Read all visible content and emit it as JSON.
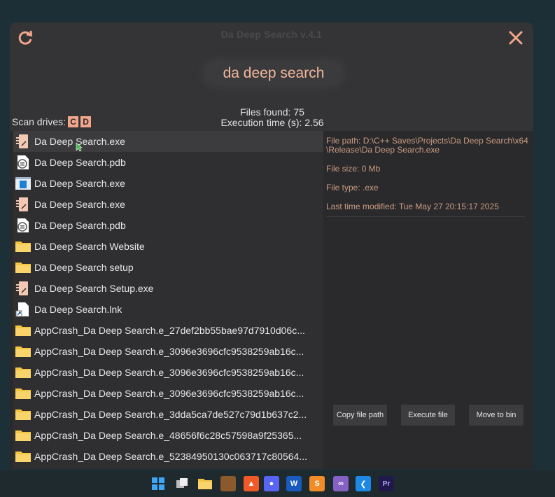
{
  "window": {
    "title": "Da Deep Search v.4.1"
  },
  "search": {
    "value": "da deep search"
  },
  "stats": {
    "files_found": "Files found: 75",
    "execution_time": "Execution time (s): 2.56"
  },
  "scan": {
    "label": "Scan drives:",
    "drives": [
      "C",
      "D"
    ]
  },
  "files": [
    {
      "name": "Da Deep Search.exe",
      "icon": "exe-icon",
      "selected": true
    },
    {
      "name": "Da Deep Search.pdb",
      "icon": "pdb-icon"
    },
    {
      "name": "Da Deep Search.exe",
      "icon": "window-app-icon"
    },
    {
      "name": "Da Deep Search.exe",
      "icon": "exe-icon"
    },
    {
      "name": "Da Deep Search.pdb",
      "icon": "pdb-icon"
    },
    {
      "name": "Da Deep Search Website",
      "icon": "folder-icon"
    },
    {
      "name": "Da Deep Search setup",
      "icon": "folder-icon"
    },
    {
      "name": "Da Deep Search Setup.exe",
      "icon": "exe-icon"
    },
    {
      "name": "Da Deep Search.lnk",
      "icon": "shortcut-icon"
    },
    {
      "name": "AppCrash_Da Deep Search.e_27def2bb55bae97d7910d06c...",
      "icon": "folder-icon"
    },
    {
      "name": "AppCrash_Da Deep Search.e_3096e3696cfc9538259ab16c...",
      "icon": "folder-icon"
    },
    {
      "name": "AppCrash_Da Deep Search.e_3096e3696cfc9538259ab16c...",
      "icon": "folder-icon"
    },
    {
      "name": "AppCrash_Da Deep Search.e_3096e3696cfc9538259ab16c...",
      "icon": "folder-icon"
    },
    {
      "name": "AppCrash_Da Deep Search.e_3dda5ca7de527c79d1b637c2...",
      "icon": "folder-icon"
    },
    {
      "name": "AppCrash_Da Deep Search.e_48656f6c28c57598a9f25365...",
      "icon": "folder-icon"
    },
    {
      "name": "AppCrash_Da Deep Search.e_52384950130c063717c80564...",
      "icon": "folder-icon"
    }
  ],
  "details": {
    "path": "File path: D:\\C++ Saves\\Projects\\Da Deep Search\\x64\\Release\\Da Deep Search.exe",
    "size": "File size: 0 Mb",
    "type": "File type: .exe",
    "modified": "Last time modified: Tue May 27 20:15:17 2025"
  },
  "actions": {
    "copy": "Copy file path",
    "execute": "Execute file",
    "bin": "Move to bin"
  },
  "taskbar": [
    "windows-start-icon",
    "task-view-icon",
    "file-explorer-icon",
    "app-icon",
    "brave-browser-icon",
    "discord-icon",
    "word-icon",
    "sublime-text-icon",
    "visual-studio-icon",
    "vscode-icon",
    "premiere-pro-icon"
  ],
  "colors": {
    "accent": "#f1a58a",
    "details_text": "#c99a82",
    "list_bg": "#2f2f31",
    "header_bg": "#343436"
  }
}
